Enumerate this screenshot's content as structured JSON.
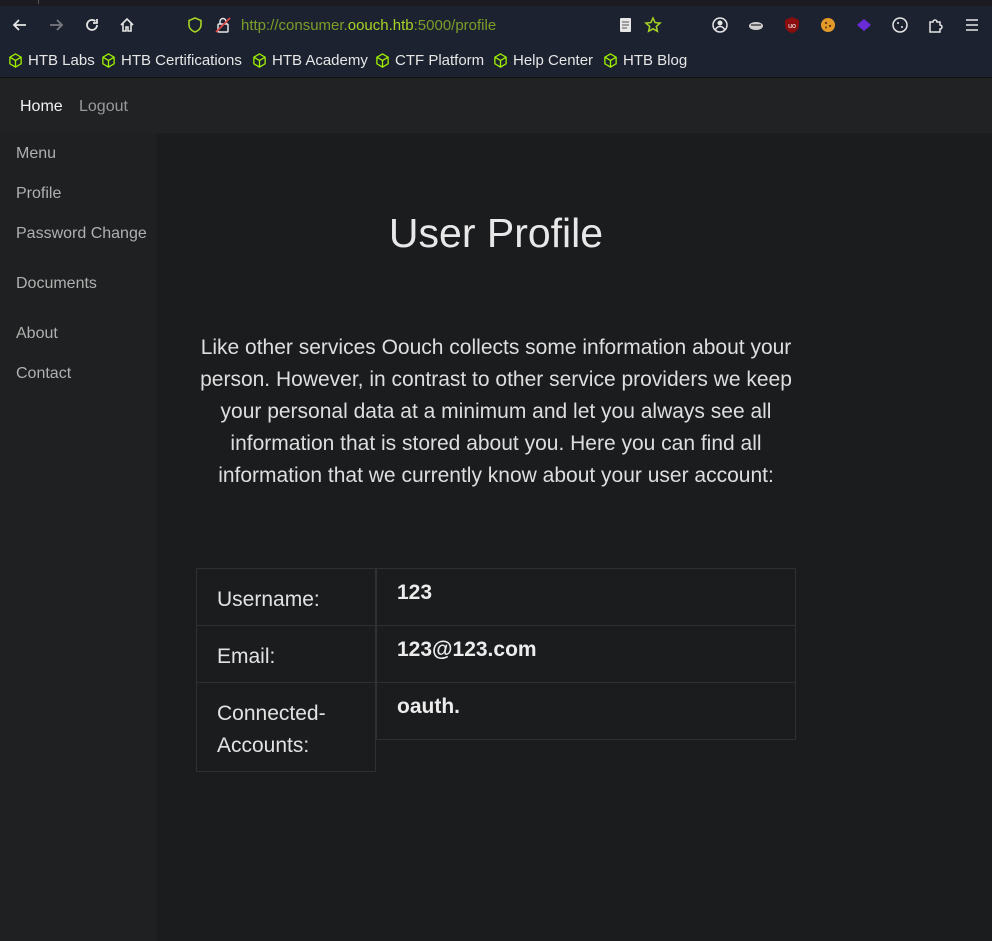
{
  "browser": {
    "url_scheme": "http://consumer.",
    "url_host": "oouch.htb",
    "url_path": ":5000/profile",
    "bookmarks": [
      "HTB Labs",
      "HTB Certifications",
      "HTB Academy",
      "CTF Platform",
      "Help Center",
      "HTB Blog"
    ]
  },
  "topnav": {
    "home": "Home",
    "logout": "Logout"
  },
  "sidebar": {
    "items": [
      "Menu",
      "Profile",
      "Password Change",
      "Documents",
      "About",
      "Contact"
    ]
  },
  "main": {
    "title": "User Profile",
    "intro": "Like other services Oouch collects some information about your person. However, in contrast to other service providers we keep your personal data at a minimum and let you always see all information that is stored about you. Here you can find all information that we currently know about your user account:",
    "table": {
      "rows": [
        {
          "label": "Username:",
          "value": "123"
        },
        {
          "label": "Email:",
          "value": "123@123.com"
        },
        {
          "label": "Connected-Accounts:",
          "value": "oauth."
        }
      ]
    }
  },
  "colors": {
    "accent_green": "#a6d325",
    "page_bg": "#1b1c1e"
  }
}
